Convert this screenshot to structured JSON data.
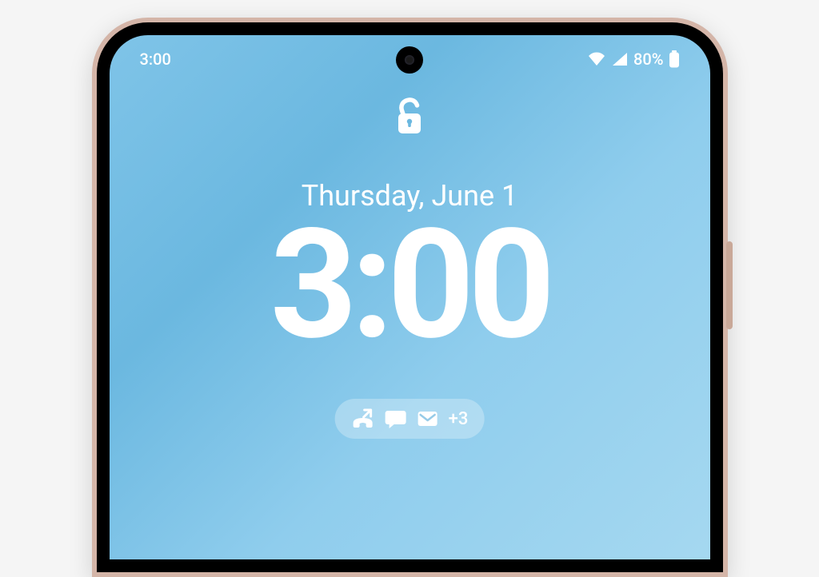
{
  "status_bar": {
    "time": "3:00",
    "battery_percent": "80%"
  },
  "lockscreen": {
    "date": "Thursday, June 1",
    "time": "3:00",
    "notification_overflow": "+3"
  }
}
